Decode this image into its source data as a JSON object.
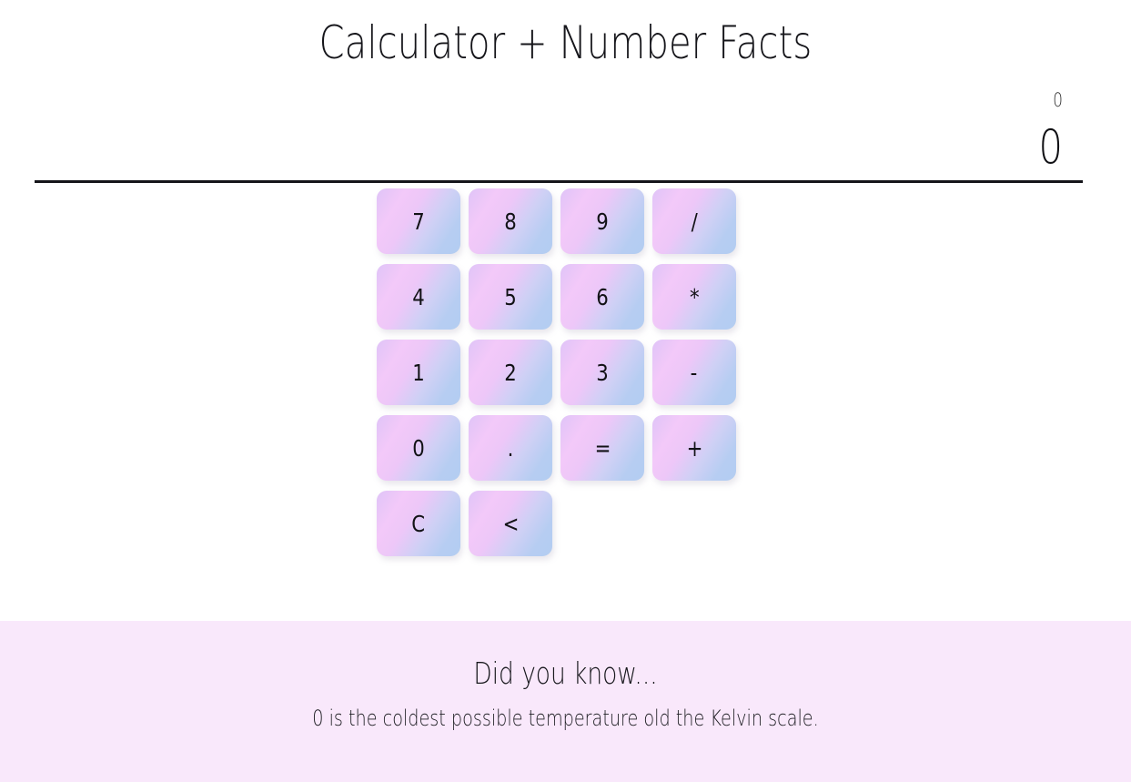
{
  "app": {
    "title": "Calculator + Number Facts"
  },
  "display": {
    "history": "0",
    "current": "0"
  },
  "keypad": {
    "keys": [
      {
        "label": "7",
        "role": "digit"
      },
      {
        "label": "8",
        "role": "digit"
      },
      {
        "label": "9",
        "role": "digit"
      },
      {
        "label": "/",
        "role": "operator-divide"
      },
      {
        "label": "4",
        "role": "digit"
      },
      {
        "label": "5",
        "role": "digit"
      },
      {
        "label": "6",
        "role": "digit"
      },
      {
        "label": "*",
        "role": "operator-multiply"
      },
      {
        "label": "1",
        "role": "digit"
      },
      {
        "label": "2",
        "role": "digit"
      },
      {
        "label": "3",
        "role": "digit"
      },
      {
        "label": "-",
        "role": "operator-subtract"
      },
      {
        "label": "0",
        "role": "digit"
      },
      {
        "label": ".",
        "role": "decimal-point"
      },
      {
        "label": "=",
        "role": "equals"
      },
      {
        "label": "+",
        "role": "operator-add"
      },
      {
        "label": "C",
        "role": "clear"
      },
      {
        "label": "<",
        "role": "backspace"
      }
    ]
  },
  "fact_panel": {
    "heading": "Did you know...",
    "text": "0 is the coldest possible temperature old the Kelvin scale."
  },
  "colors": {
    "page_background": "#ffffff",
    "key_gradient_pink": "#f3c9f9",
    "key_gradient_lavender": "#dfc4f7",
    "key_gradient_blue": "#b3cdf1",
    "fact_panel_background": "#f9e8fb",
    "rule": "#15151a",
    "text": "#15151a"
  }
}
